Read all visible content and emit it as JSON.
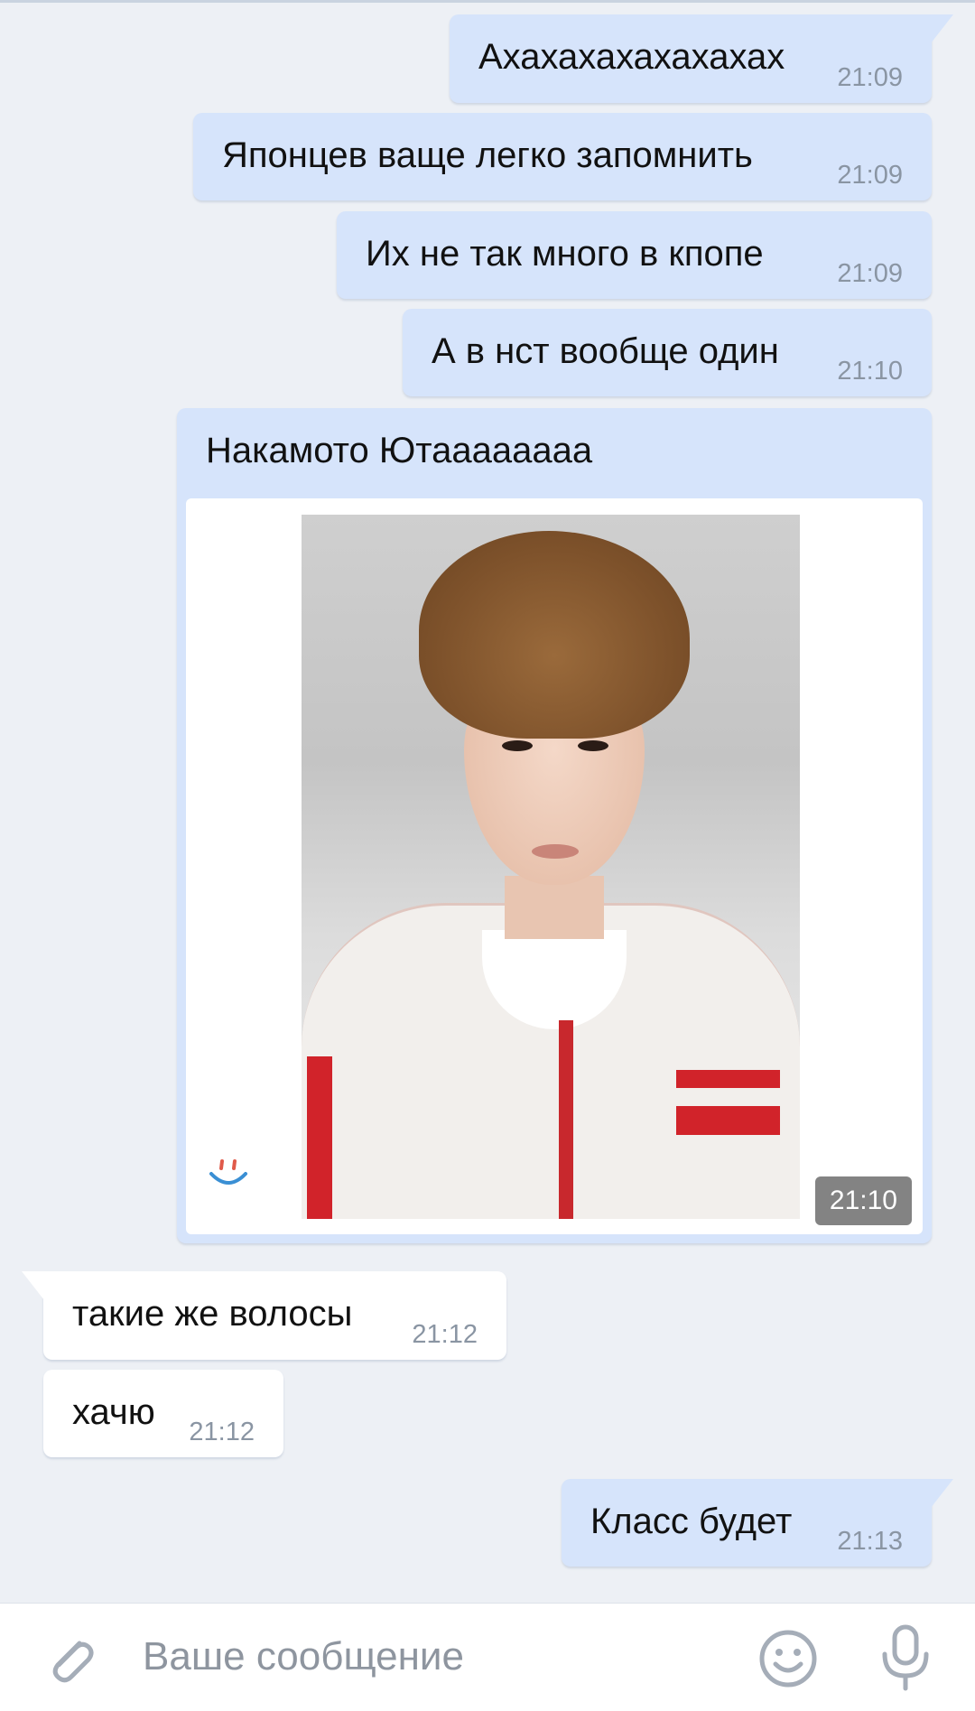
{
  "messages": [
    {
      "direction": "out",
      "text": "Ахахахахахахахах",
      "time": "21:09"
    },
    {
      "direction": "out",
      "text": "Японцев ваще легко запомнить",
      "time": "21:09"
    },
    {
      "direction": "out",
      "text": "Их не так много в кпопе",
      "time": "21:09"
    },
    {
      "direction": "out",
      "text": "А в нст вообще один",
      "time": "21:10"
    },
    {
      "direction": "out",
      "text": "Накамото Ютааааааaa",
      "time": "21:10",
      "has_photo": true
    },
    {
      "direction": "in",
      "text": "такие же волосы",
      "time": "21:12"
    },
    {
      "direction": "in",
      "text": "хачю",
      "time": "21:12"
    },
    {
      "direction": "out",
      "text": "Класс будет",
      "time": "21:13"
    }
  ],
  "composer": {
    "placeholder": "Ваше сообщение",
    "icons": [
      "paperclip-icon",
      "emoji-icon",
      "microphone-icon"
    ]
  },
  "colors": {
    "background": "#edf0f5",
    "outgoing_bubble": "#d6e4fb",
    "incoming_bubble": "#ffffff",
    "time_text": "#8a95a3",
    "icon_gray": "#a5adb8"
  }
}
